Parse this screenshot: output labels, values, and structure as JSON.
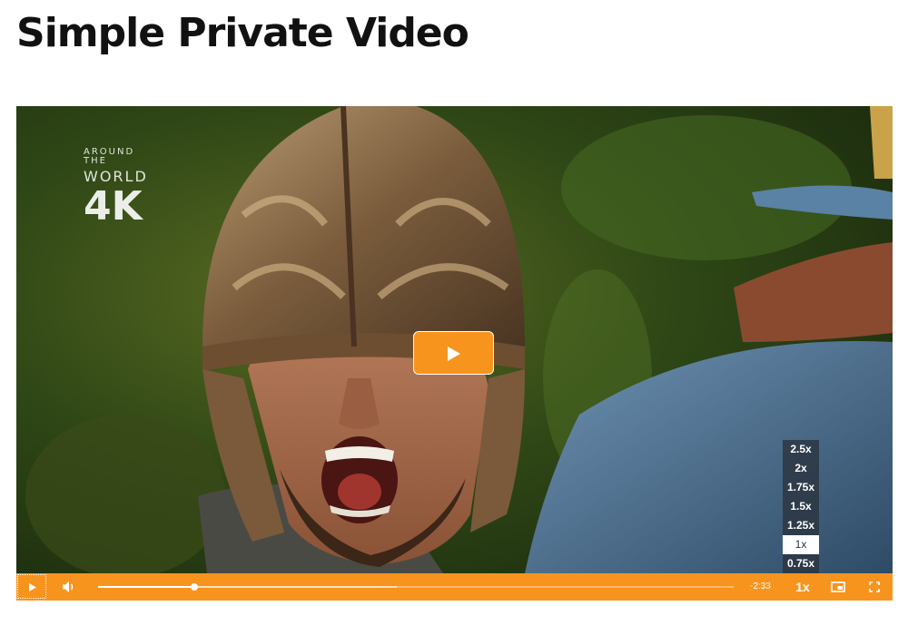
{
  "page": {
    "title": "Simple Private Video"
  },
  "watermark": {
    "line1": "AROUND THE",
    "line2": "WORLD",
    "line3": "4K"
  },
  "player": {
    "accent_color": "#f7941d",
    "big_play_icon": "play-icon",
    "remaining_time": "-2:33",
    "playback_rate": "1x",
    "progress_played_fraction": 0.152,
    "progress_buffered_fraction": 0.47,
    "speed_options": [
      {
        "label": "2.5x",
        "selected": false
      },
      {
        "label": "2x",
        "selected": false
      },
      {
        "label": "1.75x",
        "selected": false
      },
      {
        "label": "1.5x",
        "selected": false
      },
      {
        "label": "1.25x",
        "selected": false
      },
      {
        "label": "1x",
        "selected": true
      },
      {
        "label": "0.75x",
        "selected": false
      }
    ],
    "controls": {
      "play_icon": "play-icon",
      "volume_icon": "volume-icon",
      "pip_icon": "picture-in-picture-icon",
      "fullscreen_icon": "fullscreen-icon"
    }
  }
}
